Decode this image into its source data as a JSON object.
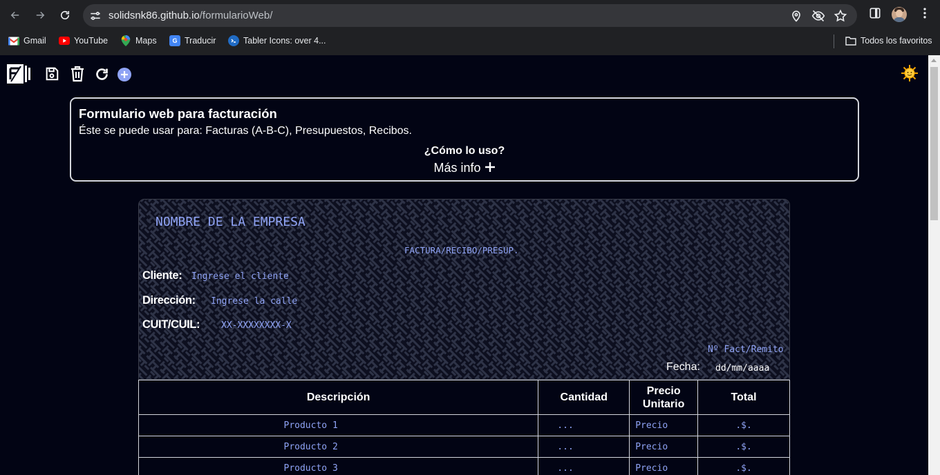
{
  "browser": {
    "url_host": "solidsnk86.github.io",
    "url_path": "/formularioWeb/",
    "bookmarks": [
      {
        "label": "Gmail",
        "icon": "gmail-icon"
      },
      {
        "label": "YouTube",
        "icon": "youtube-icon"
      },
      {
        "label": "Maps",
        "icon": "maps-icon"
      },
      {
        "label": "Traducir",
        "icon": "translate-icon"
      },
      {
        "label": "Tabler Icons: over 4...",
        "icon": "tabler-icon"
      }
    ],
    "all_bookmarks": "Todos los favoritos"
  },
  "toolbar": {
    "icons": [
      "logo-icon",
      "save-icon",
      "trash-icon",
      "refresh-icon",
      "add-icon",
      "sun-theme-icon"
    ]
  },
  "info": {
    "title": "Formulario web para facturación",
    "subtitle": "Éste se puede usar para: Facturas (A-B-C), Presupuestos, Recibos.",
    "how": "¿Cómo lo uso?",
    "more": "Más info"
  },
  "invoice": {
    "company": "NOMBRE DE LA EMPRESA",
    "doc_type": "FACTURA/RECIBO/PRESUP.",
    "client_label": "Cliente:",
    "client_value": "Ingrese el cliente",
    "address_label": "Dirección:",
    "address_value": "Ingrese la calle",
    "cuit_label": "CUIT/CUIL:",
    "cuit_value": "XX-XXXXXXXX-X",
    "number": "Nº Fact/Remito",
    "date_label": "Fecha:",
    "date_value": "dd/mm/aaaa"
  },
  "table": {
    "headers": {
      "desc": "Descripción",
      "qty": "Cantidad",
      "price_1": "Precio",
      "price_2": "Unitario",
      "total": "Total"
    },
    "rows": [
      {
        "desc": "Producto 1",
        "qty": "...",
        "price": "Precio",
        "total": ".$."
      },
      {
        "desc": "Producto 2",
        "qty": "...",
        "price": "Precio",
        "total": ".$."
      },
      {
        "desc": "Producto 3",
        "qty": "...",
        "price": "Precio",
        "total": ".$."
      }
    ]
  },
  "colors": {
    "page_bg": "#020414",
    "accent": "#8fa3f5",
    "border": "#d4d6dc"
  }
}
